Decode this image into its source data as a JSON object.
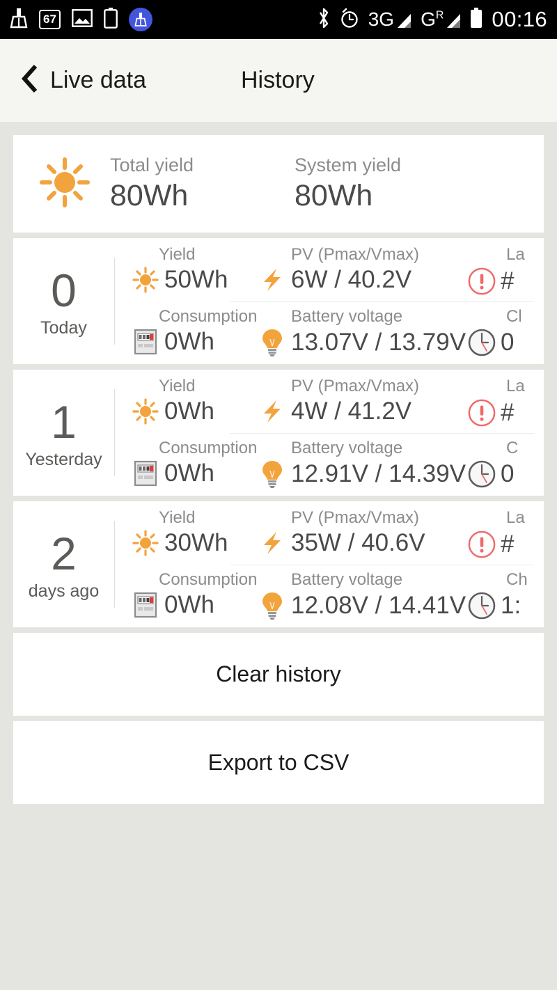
{
  "status_bar": {
    "left_icons": [
      "broom-icon",
      "battery-percent-badge",
      "picture-icon",
      "battery-outline-icon",
      "cleaner-badge-icon"
    ],
    "battery_badge_text": "67",
    "right_icons": [
      "bluetooth-icon",
      "alarm-clock-icon",
      "signal-3g-icon",
      "signal-gr-icon",
      "battery-icon"
    ],
    "network_3g": "3G",
    "network_g": "G",
    "network_g_sup": "R",
    "clock": "00:16"
  },
  "navbar": {
    "back_label": "Live data",
    "title": "History"
  },
  "summary": {
    "sun_icon": "sun-icon",
    "total_yield_label": "Total yield",
    "total_yield_value": "80Wh",
    "system_yield_label": "System yield",
    "system_yield_value": "80Wh"
  },
  "labels": {
    "yield": "Yield",
    "pv": "PV (Pmax/Vmax)",
    "consumption": "Consumption",
    "battery_voltage": "Battery voltage",
    "last_error_truncated": "La",
    "charge_time_truncated": "Cl",
    "charge_time_truncated_alt": "C",
    "charge_time_truncated_alt2": "Ch"
  },
  "days": [
    {
      "index": "0",
      "name": "Today",
      "yield": "50Wh",
      "pv": "6W / 40.2V",
      "consumption": "0Wh",
      "battery_voltage": "13.07V / 13.79V",
      "last_error_label": "La",
      "last_error_value": "#",
      "charge_time_label": "Cl",
      "charge_time_value": "0"
    },
    {
      "index": "1",
      "name": "Yesterday",
      "yield": "0Wh",
      "pv": "4W / 41.2V",
      "consumption": "0Wh",
      "battery_voltage": "12.91V / 14.39V",
      "last_error_label": "La",
      "last_error_value": "#",
      "charge_time_label": "C",
      "charge_time_value": "0"
    },
    {
      "index": "2",
      "name": "days ago",
      "yield": "30Wh",
      "pv": "35W / 40.6V",
      "consumption": "0Wh",
      "battery_voltage": "12.08V / 14.41V",
      "last_error_label": "La",
      "last_error_value": "#",
      "charge_time_label": "Ch",
      "charge_time_value": "1:"
    }
  ],
  "actions": {
    "clear_history": "Clear history",
    "export_csv": "Export to CSV"
  },
  "colors": {
    "accent_orange": "#F2A33C",
    "error_red": "#EF6A6A",
    "page_bg": "#E4E5E1",
    "navbar_bg": "#F5F5F1",
    "card_bg": "#FFFFFF",
    "text_primary": "#4A4A4A",
    "text_muted": "#8C8C8C"
  }
}
